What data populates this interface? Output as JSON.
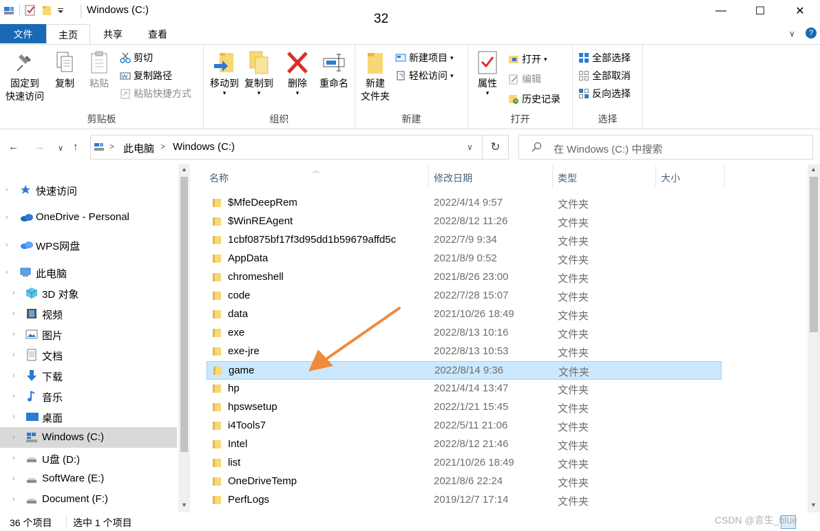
{
  "window": {
    "title": "Windows (C:)",
    "overlay_number": "32",
    "minimize": "—",
    "maximize": "☐",
    "close": "✕"
  },
  "tabs": {
    "file": "文件",
    "home": "主页",
    "share": "共享",
    "view": "查看",
    "expand": "∨",
    "help": "?"
  },
  "ribbon": {
    "clipboard": {
      "label": "剪贴板",
      "pin_line1": "固定到",
      "pin_line2": "快速访问",
      "copy": "复制",
      "paste": "粘贴",
      "cut": "剪切",
      "copy_path": "复制路径",
      "paste_shortcut": "粘贴快捷方式"
    },
    "organize": {
      "label": "组织",
      "move_to": "移动到",
      "copy_to": "复制到",
      "delete": "删除",
      "rename": "重命名"
    },
    "new": {
      "label": "新建",
      "new_folder_line1": "新建",
      "new_folder_line2": "文件夹",
      "new_item": "新建项目",
      "easy_access": "轻松访问"
    },
    "open": {
      "label": "打开",
      "properties": "属性",
      "open": "打开",
      "edit": "编辑",
      "history": "历史记录"
    },
    "select": {
      "label": "选择",
      "select_all": "全部选择",
      "select_none": "全部取消",
      "invert": "反向选择"
    }
  },
  "address": {
    "segments": [
      "此电脑",
      "Windows (C:)"
    ],
    "separator": ">",
    "search_placeholder": "在 Windows (C:) 中搜索"
  },
  "nav": {
    "items": [
      {
        "label": "快速访问",
        "icon": "star-icon",
        "level": 0
      },
      {
        "label": "OneDrive - Personal",
        "icon": "cloud-icon",
        "level": 0
      },
      {
        "label": "WPS网盘",
        "icon": "wps-cloud-icon",
        "level": 0
      },
      {
        "label": "此电脑",
        "icon": "computer-icon",
        "level": 0
      },
      {
        "label": "3D 对象",
        "icon": "cube-icon",
        "level": 1
      },
      {
        "label": "视频",
        "icon": "video-icon",
        "level": 1
      },
      {
        "label": "图片",
        "icon": "picture-icon",
        "level": 1
      },
      {
        "label": "文档",
        "icon": "document-icon",
        "level": 1
      },
      {
        "label": "下载",
        "icon": "download-icon",
        "level": 1
      },
      {
        "label": "音乐",
        "icon": "music-icon",
        "level": 1
      },
      {
        "label": "桌面",
        "icon": "desktop-icon",
        "level": 1
      },
      {
        "label": "Windows (C:)",
        "icon": "windows-drive-icon",
        "level": 1
      },
      {
        "label": "U盘 (D:)",
        "icon": "drive-icon",
        "level": 1
      },
      {
        "label": "SoftWare (E:)",
        "icon": "drive-icon",
        "level": 1
      },
      {
        "label": "Document (F:)",
        "icon": "drive-icon",
        "level": 1
      }
    ]
  },
  "columns": {
    "name": "名称",
    "modified": "修改日期",
    "type": "类型",
    "size": "大小"
  },
  "files": [
    {
      "name": "$MfeDeepRem",
      "date": "2022/4/14 9:57",
      "type": "文件夹"
    },
    {
      "name": "$WinREAgent",
      "date": "2022/8/12 11:26",
      "type": "文件夹"
    },
    {
      "name": "1cbf0875bf17f3d95dd1b59679affd5c",
      "date": "2022/7/9 9:34",
      "type": "文件夹"
    },
    {
      "name": "AppData",
      "date": "2021/8/9 0:52",
      "type": "文件夹"
    },
    {
      "name": "chromeshell",
      "date": "2021/8/26 23:00",
      "type": "文件夹"
    },
    {
      "name": "code",
      "date": "2022/7/28 15:07",
      "type": "文件夹"
    },
    {
      "name": "data",
      "date": "2021/10/26 18:49",
      "type": "文件夹"
    },
    {
      "name": "exe",
      "date": "2022/8/13 10:16",
      "type": "文件夹"
    },
    {
      "name": "exe-jre",
      "date": "2022/8/13 10:53",
      "type": "文件夹"
    },
    {
      "name": "game",
      "date": "2022/8/14 9:36",
      "type": "文件夹"
    },
    {
      "name": "hp",
      "date": "2021/4/14 13:47",
      "type": "文件夹"
    },
    {
      "name": "hpswsetup",
      "date": "2022/1/21 15:45",
      "type": "文件夹"
    },
    {
      "name": "i4Tools7",
      "date": "2022/5/11 21:06",
      "type": "文件夹"
    },
    {
      "name": "Intel",
      "date": "2022/8/12 21:46",
      "type": "文件夹"
    },
    {
      "name": "list",
      "date": "2021/10/26 18:49",
      "type": "文件夹"
    },
    {
      "name": "OneDriveTemp",
      "date": "2021/8/6 22:24",
      "type": "文件夹"
    },
    {
      "name": "PerfLogs",
      "date": "2019/12/7 17:14",
      "type": "文件夹"
    }
  ],
  "selected_file": "game",
  "status": {
    "count": "36 个项目",
    "selected": "选中 1 个项目"
  },
  "watermark": "CSDN @言生_blue",
  "colors": {
    "file_tab": "#1a69b6",
    "selection": "#cce8ff",
    "selection_border": "#99d1ff",
    "folder": "#f8d775",
    "arrow": "#f08a3c"
  }
}
